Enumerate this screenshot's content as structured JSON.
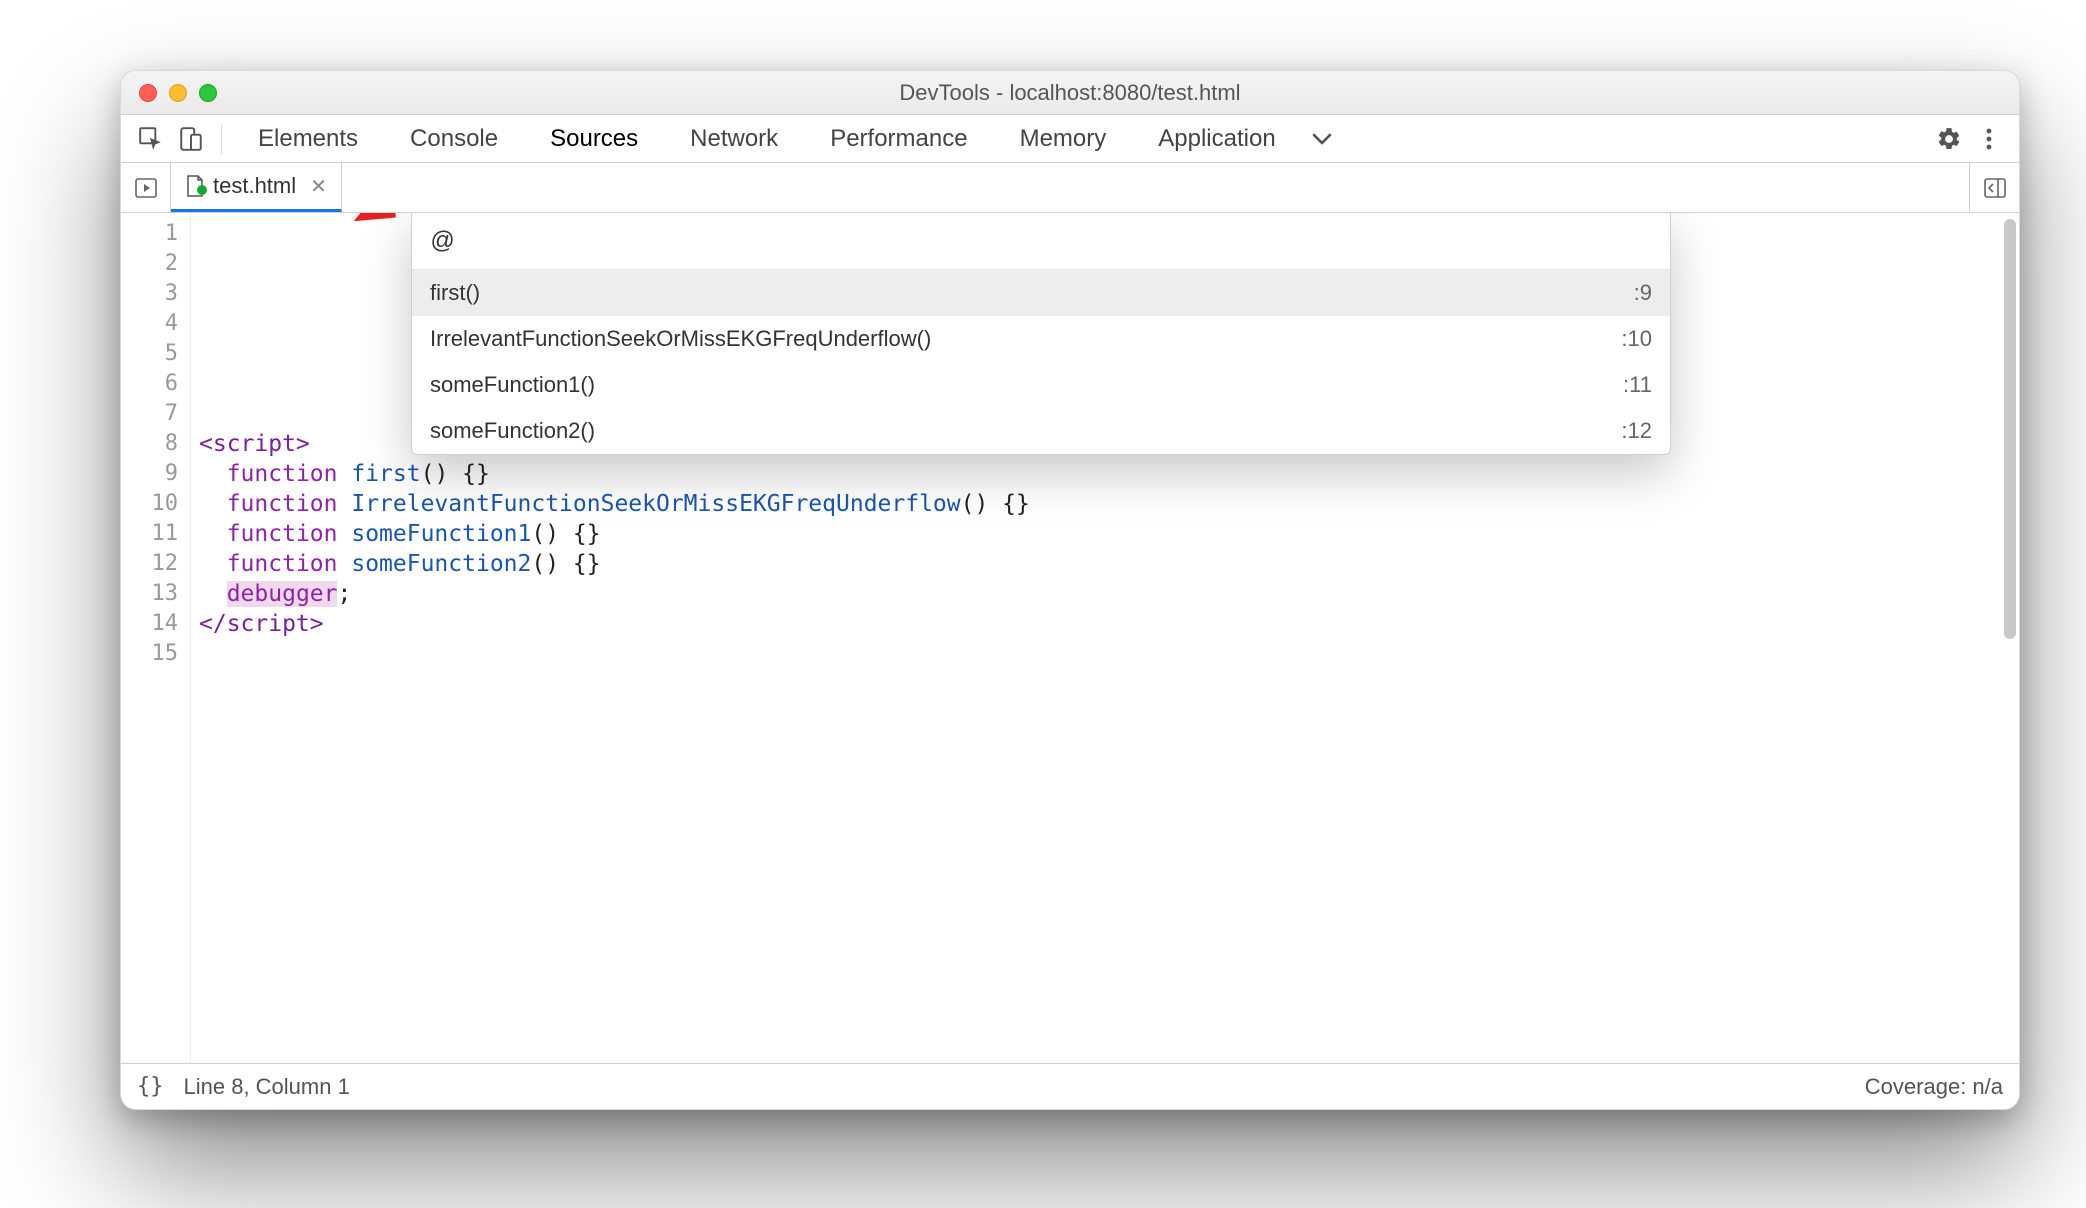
{
  "window": {
    "title": "DevTools - localhost:8080/test.html"
  },
  "tabs": {
    "items": [
      "Elements",
      "Console",
      "Sources",
      "Network",
      "Performance",
      "Memory",
      "Application"
    ],
    "active": "Sources"
  },
  "fileTab": {
    "name": "test.html"
  },
  "quickOpen": {
    "query": "@",
    "items": [
      {
        "label": "first()",
        "loc": ":9"
      },
      {
        "label": "IrrelevantFunctionSeekOrMissEKGFreqUnderflow()",
        "loc": ":10"
      },
      {
        "label": "someFunction1()",
        "loc": ":11"
      },
      {
        "label": "someFunction2()",
        "loc": ":12"
      }
    ]
  },
  "editor": {
    "lineCount": 15,
    "codeHtml": "\n\n\n\n\n\n\n<span class='tok-tag'>&lt;script&gt;</span>\n  <span class='tok-kw'>function</span> <span class='tok-fn'>first</span>() {}\n  <span class='tok-kw'>function</span> <span class='tok-fn'>IrrelevantFunctionSeekOrMissEKGFreqUnderflow</span>() {}\n  <span class='tok-kw'>function</span> <span class='tok-fn'>someFunction1</span>() {}\n  <span class='tok-kw'>function</span> <span class='tok-fn'>someFunction2</span>() {}\n  <span class='tok-debug'>debugger</span>;\n<span class='tok-tag'>&lt;/script&gt;</span>\n"
  },
  "status": {
    "cursor": "Line 8, Column 1",
    "coverage": "Coverage: n/a",
    "bracesIcon": "{}"
  }
}
